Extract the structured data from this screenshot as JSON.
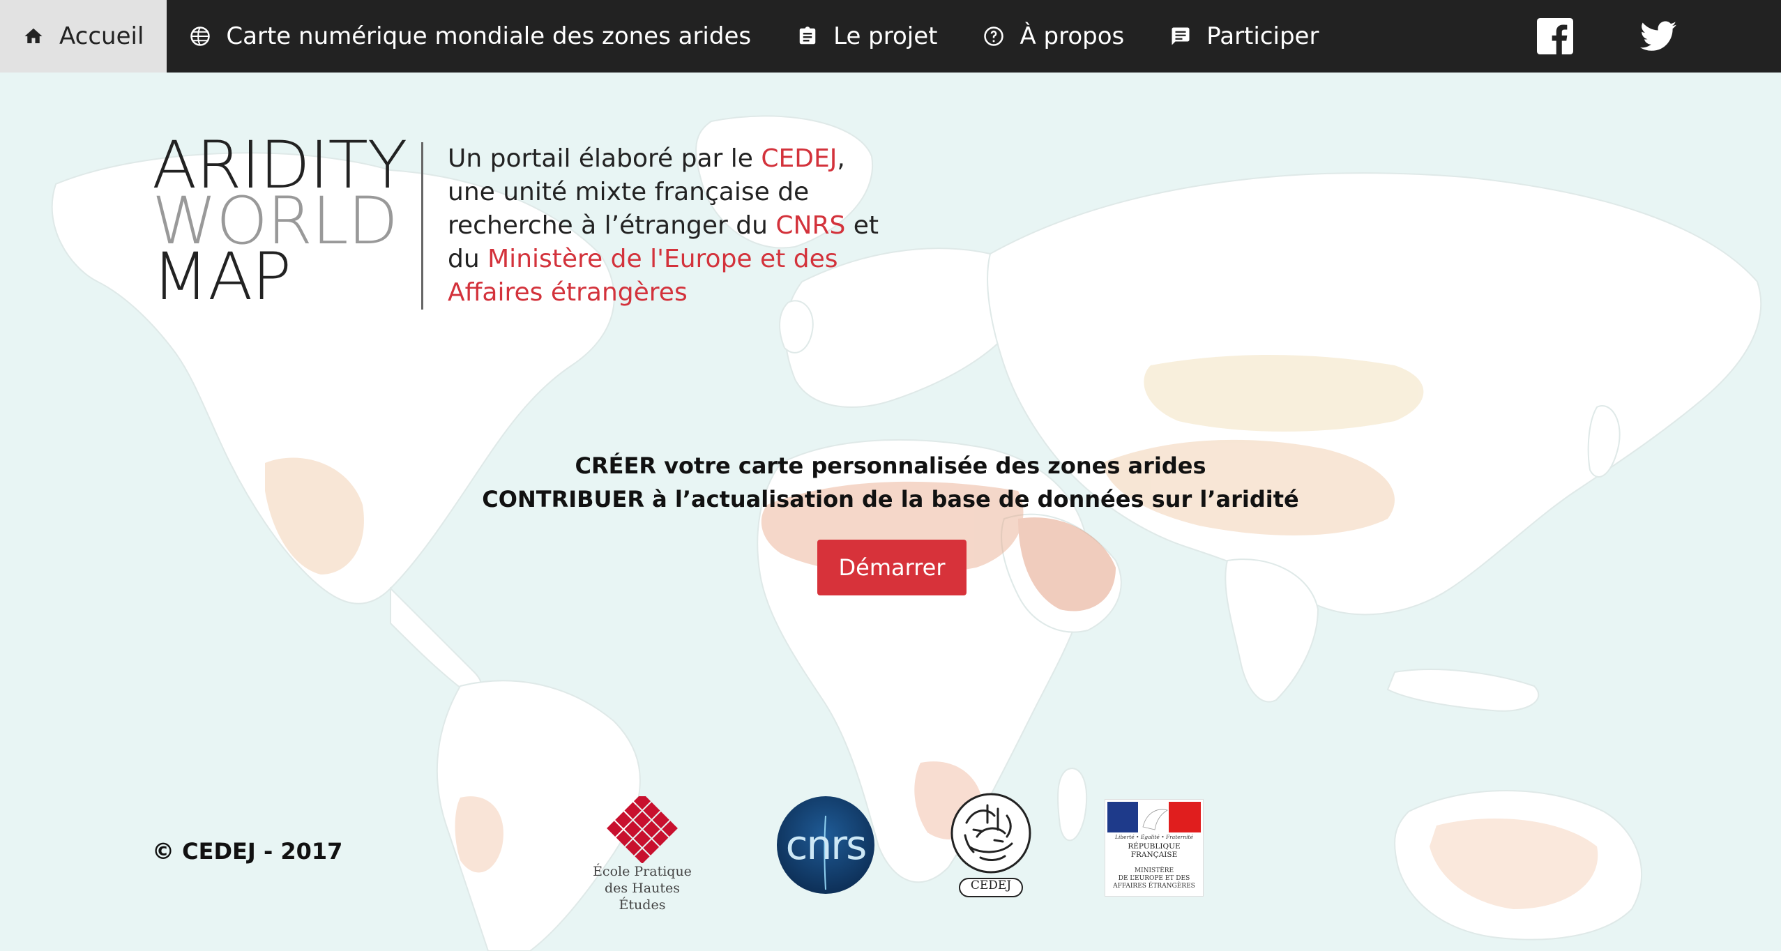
{
  "nav": {
    "items": [
      {
        "label": "Accueil",
        "icon": "home-icon",
        "active": true
      },
      {
        "label": "Carte numérique mondiale des zones arides",
        "icon": "globe-icon",
        "active": false
      },
      {
        "label": "Le projet",
        "icon": "clipboard-icon",
        "active": false
      },
      {
        "label": "À propos",
        "icon": "help-circle-icon",
        "active": false
      },
      {
        "label": "Participer",
        "icon": "comment-icon",
        "active": false
      }
    ],
    "social": [
      "facebook-icon",
      "twitter-icon"
    ]
  },
  "brand": {
    "line1": "ARIDITY",
    "line2": "WORLD",
    "line3": "MAP"
  },
  "intro": {
    "t1": "Un portail élaboré par le ",
    "l1": "CEDEJ",
    "t2": ", une unité mixte française de recherche à l’étranger du ",
    "l2": "CNRS",
    "t3": " et du ",
    "l3": "Ministère de l'Europe et des Affaires étrangères"
  },
  "cta": {
    "line1": "CRÉER votre carte personnalisée des zones arides",
    "line2": "CONTRIBUER à l’actualisation de la base de données sur l’aridité",
    "button": "Démarrer"
  },
  "footer": {
    "copyright": "© CEDEJ - 2017",
    "ephe_line1": "École Pratique",
    "ephe_line2": "des Hautes Études",
    "cnrs": "cnrs",
    "cedej": "CEDEJ",
    "mae_motto": "Liberté • Égalité • Fraternité",
    "mae_republic": "RÉPUBLIQUE FRANÇAISE",
    "mae_ministry_1": "MINISTÈRE",
    "mae_ministry_2": "DE L’EUROPE ET DES",
    "mae_ministry_3": "AFFAIRES ÉTRANGÈRES"
  },
  "colors": {
    "accent": "#d7323a",
    "nav_bg": "#222222",
    "ocean": "#e8f5f4"
  }
}
